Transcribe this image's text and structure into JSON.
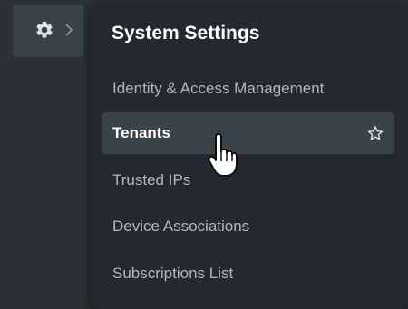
{
  "sidebar": {
    "trigger_icon": "gear-icon",
    "expand_icon": "chevron-right-icon"
  },
  "menu": {
    "title": "System Settings",
    "items": [
      {
        "label": "Identity & Access Management"
      },
      {
        "label": "Tenants",
        "hovered": true,
        "favorite_icon": "star-outline-icon"
      },
      {
        "label": "Trusted IPs"
      },
      {
        "label": "Device Associations"
      },
      {
        "label": "Subscriptions List"
      }
    ]
  },
  "cursor": "hand-pointer-icon",
  "colors": {
    "background": "#2b3136",
    "flyout": "#23292f",
    "hover": "#3b434a",
    "text": "#b1b8bf",
    "title": "#ffffff"
  }
}
